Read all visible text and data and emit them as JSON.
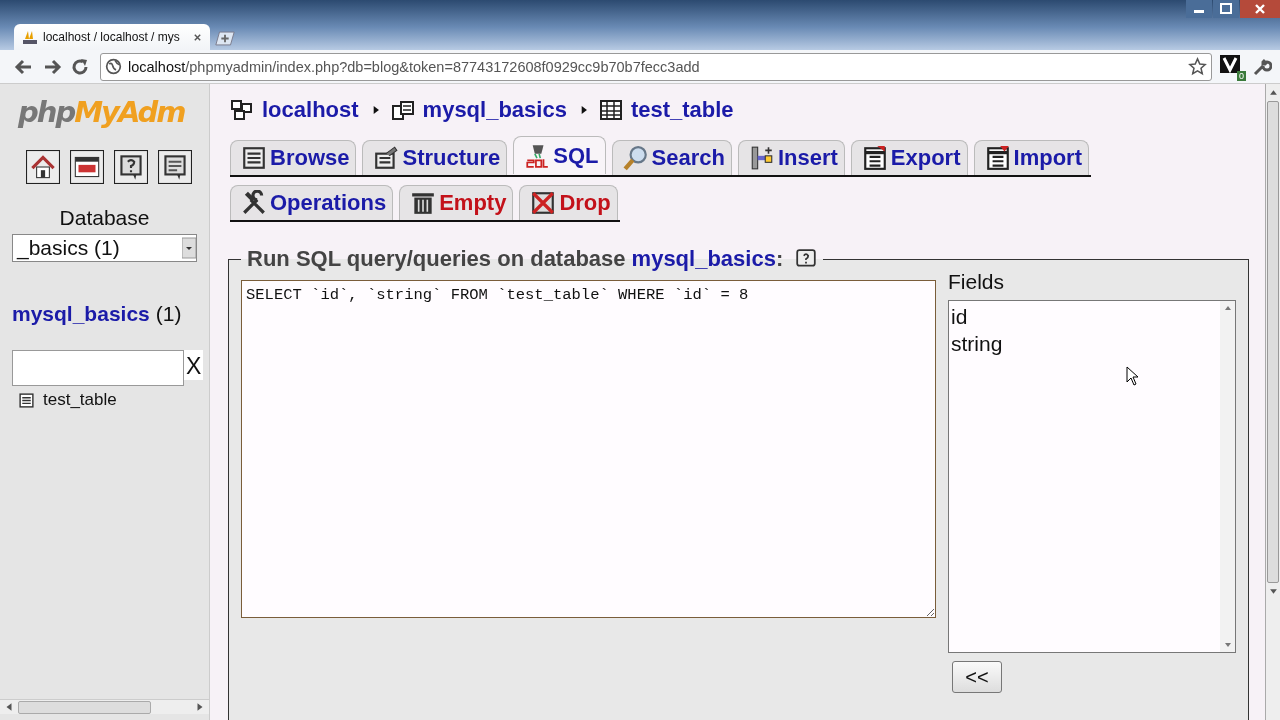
{
  "browser": {
    "tab_title": "localhost / localhost / mys",
    "url_host": "localhost",
    "url_path": "/phpmyadmin/index.php?db=blog&token=87743172608f0929cc9b70b7fecc3add",
    "extension_badge": "0"
  },
  "sidebar": {
    "logo": "phpMyAdm",
    "database_label": "Database",
    "database_select": "_basics (1)",
    "database_link": "mysql_basics",
    "table_count": "(1)",
    "filter_clear": "X",
    "tables": [
      "test_table"
    ]
  },
  "breadcrumb": [
    "localhost",
    "mysql_basics",
    "test_table"
  ],
  "tabs": [
    [
      {
        "label": "Browse",
        "selected": false,
        "kind": "normal"
      },
      {
        "label": "Structure",
        "selected": false,
        "kind": "normal"
      },
      {
        "label": "SQL",
        "selected": true,
        "kind": "normal"
      },
      {
        "label": "Search",
        "selected": false,
        "kind": "normal"
      },
      {
        "label": "Insert",
        "selected": false,
        "kind": "normal"
      },
      {
        "label": "Export",
        "selected": false,
        "kind": "normal"
      },
      {
        "label": "Import",
        "selected": false,
        "kind": "normal"
      }
    ],
    [
      {
        "label": "Operations",
        "selected": false,
        "kind": "normal"
      },
      {
        "label": "Empty",
        "selected": false,
        "kind": "danger"
      },
      {
        "label": "Drop",
        "selected": false,
        "kind": "danger"
      }
    ]
  ],
  "query_panel": {
    "legend": "Run SQL query/queries on database",
    "database": "mysql_basics",
    "suffix": ":",
    "query": "SELECT `id`, `string` FROM `test_table` WHERE `id` = 8",
    "fields_label": "Fields",
    "fields": [
      "id",
      "string"
    ],
    "insert_button": "<<"
  }
}
